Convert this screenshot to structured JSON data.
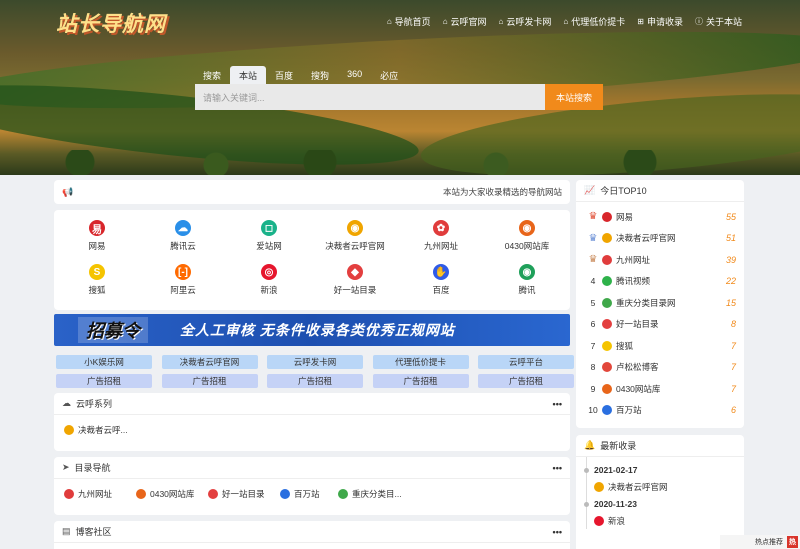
{
  "site": {
    "logo": "站长导航网"
  },
  "topnav": [
    {
      "icon": "home-icon",
      "glyph": "⌂",
      "label": "导航首页"
    },
    {
      "icon": "home-icon",
      "glyph": "⌂",
      "label": "云呼官网"
    },
    {
      "icon": "home-icon",
      "glyph": "⌂",
      "label": "云呼发卡网"
    },
    {
      "icon": "home-icon",
      "glyph": "⌂",
      "label": "代理低价提卡"
    },
    {
      "icon": "plus-square-icon",
      "glyph": "⊞",
      "label": "申请收录"
    },
    {
      "icon": "info-icon",
      "glyph": "ⓘ",
      "label": "关于本站"
    }
  ],
  "search": {
    "tabs": [
      "搜索",
      "本站",
      "百度",
      "搜狗",
      "360",
      "必应"
    ],
    "active_tab": "本站",
    "placeholder": "请输入关键词...",
    "button": "本站搜索"
  },
  "notice": {
    "icon": "megaphone-icon",
    "text": "本站为大家收录精选的导航网站"
  },
  "hot_sites": [
    {
      "name": "网易",
      "color": "#d8262b",
      "glyph": "易"
    },
    {
      "name": "腾讯云",
      "color": "#2a8fe8",
      "glyph": "☁"
    },
    {
      "name": "爱站网",
      "color": "#1ab28a",
      "glyph": "◻"
    },
    {
      "name": "决裁者云呼官网",
      "color": "#f0a500",
      "glyph": "◉"
    },
    {
      "name": "九州网址",
      "color": "#e03c3c",
      "glyph": "✿"
    },
    {
      "name": "0430网站库",
      "color": "#e8651a",
      "glyph": "◉"
    },
    {
      "name": "搜狐",
      "color": "#f5c400",
      "glyph": "S"
    },
    {
      "name": "阿里云",
      "color": "#ff6a00",
      "glyph": "[-]"
    },
    {
      "name": "新浪",
      "color": "#e6162d",
      "glyph": "◎"
    },
    {
      "name": "好一站目录",
      "color": "#e33f3f",
      "glyph": "◆"
    },
    {
      "name": "百度",
      "color": "#2f5be8",
      "glyph": "✋"
    },
    {
      "name": "腾讯",
      "color": "#1fa05a",
      "glyph": "◉"
    }
  ],
  "banner": {
    "title": "招募令",
    "slogan": "全人工审核  无条件收录各类优秀正规网站"
  },
  "chips_row1": [
    "小K娱乐网",
    "决裁者云呼官网",
    "云呼发卡网",
    "代理低价提卡",
    "云呼平台"
  ],
  "chips_row2": [
    "广告招租",
    "广告招租",
    "广告招租",
    "广告招租",
    "广告招租"
  ],
  "sections": [
    {
      "title": "云呼系列",
      "icon": "cloud-icon",
      "glyph": "☁",
      "more": "•••",
      "links": [
        {
          "name": "决裁者云呼...",
          "color": "#f0a500"
        }
      ]
    },
    {
      "title": "目录导航",
      "icon": "send-icon",
      "glyph": "➤",
      "more": "•••",
      "links": [
        {
          "name": "九州网址",
          "color": "#e03c3c"
        },
        {
          "name": "0430网站库",
          "color": "#e8651a"
        },
        {
          "name": "好一站目录",
          "color": "#e33f3f"
        },
        {
          "name": "百万站",
          "color": "#2a6fe0"
        },
        {
          "name": "重庆分类目...",
          "color": "#3fa84a"
        }
      ]
    },
    {
      "title": "博客社区",
      "icon": "doc-icon",
      "glyph": "▤",
      "more": "•••",
      "links": []
    }
  ],
  "top10": {
    "title": "今日TOP10",
    "icon": "chart-icon",
    "items": [
      {
        "rank": "1",
        "name": "网易",
        "value": "55",
        "color": "#d8262b"
      },
      {
        "rank": "2",
        "name": "决裁者云呼官网",
        "value": "51",
        "color": "#f0a500"
      },
      {
        "rank": "3",
        "name": "九州网址",
        "value": "39",
        "color": "#e03c3c"
      },
      {
        "rank": "4",
        "name": "腾讯视频",
        "value": "22",
        "color": "#2eb24a"
      },
      {
        "rank": "5",
        "name": "重庆分类目录网",
        "value": "15",
        "color": "#3fa84a"
      },
      {
        "rank": "6",
        "name": "好一站目录",
        "value": "8",
        "color": "#e33f3f"
      },
      {
        "rank": "7",
        "name": "搜狐",
        "value": "7",
        "color": "#f5c400"
      },
      {
        "rank": "8",
        "name": "卢松松博客",
        "value": "7",
        "color": "#e2473a"
      },
      {
        "rank": "9",
        "name": "0430网站库",
        "value": "7",
        "color": "#e8651a"
      },
      {
        "rank": "10",
        "name": "百万站",
        "value": "6",
        "color": "#2a6fe0"
      }
    ]
  },
  "latest": {
    "title": "最新收录",
    "icon": "bell-icon",
    "entries": [
      {
        "date": "2021-02-17",
        "name": "决裁者云呼官网",
        "color": "#f0a500"
      },
      {
        "date": "2020-11-23",
        "name": "新浪",
        "color": "#e6162d"
      }
    ]
  },
  "footer": {
    "label": "热点推荐",
    "badge": "热"
  }
}
